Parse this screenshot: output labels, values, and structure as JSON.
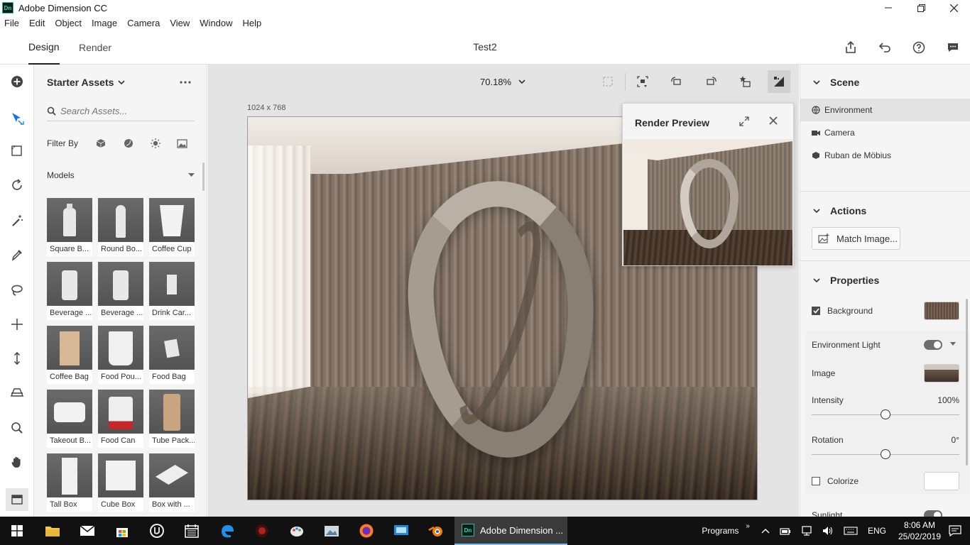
{
  "window": {
    "title": "Adobe Dimension CC",
    "logo": "Dn"
  },
  "menu": [
    "File",
    "Edit",
    "Object",
    "Image",
    "Camera",
    "View",
    "Window",
    "Help"
  ],
  "tabs": {
    "design": "Design",
    "render": "Render"
  },
  "document_title": "Test2",
  "assets": {
    "title": "Starter Assets",
    "search_placeholder": "Search Assets...",
    "filter_label": "Filter By",
    "category": "Models",
    "items": [
      "Square B...",
      "Round Bo...",
      "Coffee Cup",
      "Beverage ...",
      "Beverage ...",
      "Drink Car...",
      "Coffee Bag",
      "Food Pou...",
      "Food Bag",
      "Takeout B...",
      "Food Can",
      "Tube Pack...",
      "Tall Box",
      "Cube Box",
      "Box with ..."
    ]
  },
  "canvas": {
    "zoom": "70.18%",
    "dimensions": "1024 x 768"
  },
  "render_preview": {
    "title": "Render Preview"
  },
  "scene": {
    "title": "Scene",
    "items": [
      "Environment",
      "Camera",
      "Ruban de Möbius"
    ]
  },
  "actions": {
    "title": "Actions",
    "match_image": "Match Image..."
  },
  "properties": {
    "title": "Properties",
    "background": "Background",
    "environment_light": "Environment Light",
    "image": "Image",
    "intensity": {
      "label": "Intensity",
      "value": "100%",
      "level": 0.5
    },
    "rotation": {
      "label": "Rotation",
      "value": "0°",
      "level": 0.5
    },
    "colorize": "Colorize",
    "sunlight": "Sunlight"
  },
  "taskbar": {
    "active_app": "Adobe Dimension ...",
    "programs": "Programs",
    "language": "ENG",
    "time": "8:06 AM",
    "date": "25/02/2019"
  },
  "colors": {
    "accent": "#2c2c2c",
    "panel": "#f5f5f5",
    "canvas": "#e4e4e4",
    "taskbar": "#111111"
  }
}
